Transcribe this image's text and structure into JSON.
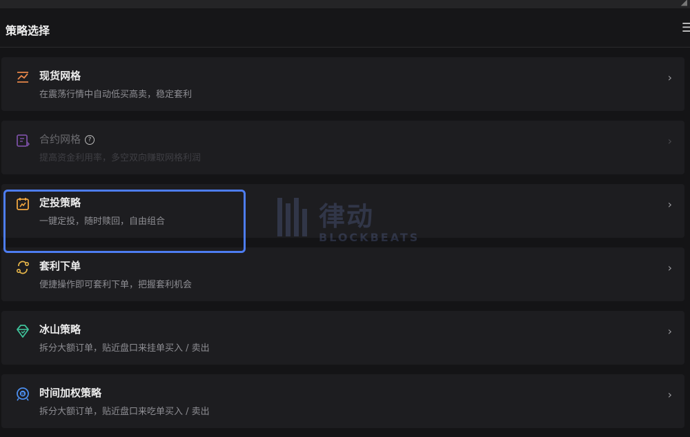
{
  "header": {
    "title": "策略选择",
    "menu_icon": "menu-icon"
  },
  "strategies": [
    {
      "title": "现货网格",
      "desc": "在震荡行情中自动低买高卖，稳定套利",
      "icon": "grid-chart-icon",
      "icon_color": "#e8864a"
    },
    {
      "title": "合约网格",
      "desc": "提高资金利用率，多空双向赚取网格利润",
      "icon": "contract-icon",
      "icon_color": "#7a4fa3",
      "disabled": true,
      "help_icon": "help-circle-icon"
    },
    {
      "title": "定投策略",
      "desc": "一键定投，随时赎回，自由组合",
      "icon": "calendar-icon",
      "icon_color": "#f0a640"
    },
    {
      "title": "套利下单",
      "desc": "便捷操作即可套利下单，把握套利机会",
      "icon": "arbitrage-icon",
      "icon_color": "#e9b84a"
    },
    {
      "title": "冰山策略",
      "desc": "拆分大额订单，贴近盘口来挂单买入 / 卖出",
      "icon": "iceberg-icon",
      "icon_color": "#3fc29a"
    },
    {
      "title": "时间加权策略",
      "desc": "拆分大额订单，贴近盘口来吃单买入 / 卖出",
      "icon": "twap-icon",
      "icon_color": "#4c8ff0"
    }
  ],
  "watermark": {
    "cn": "律动",
    "en": "BLOCKBEATS"
  },
  "chevron": "›",
  "help_glyph": "?"
}
